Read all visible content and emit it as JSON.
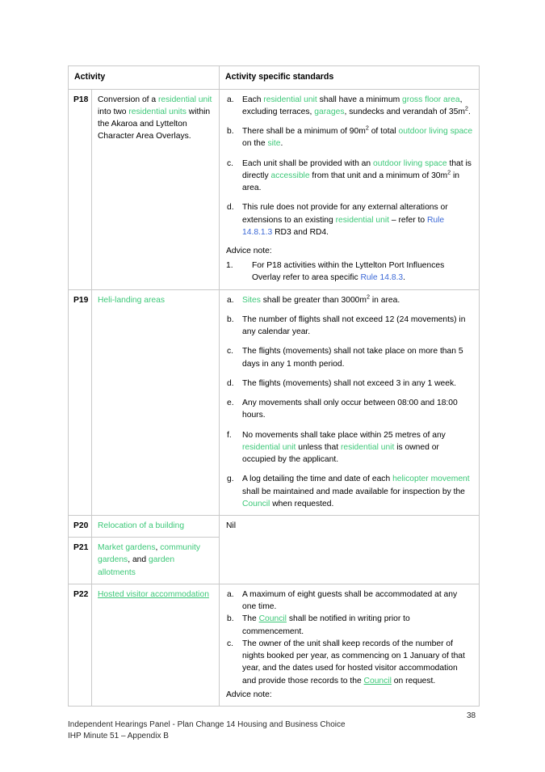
{
  "document": {
    "page_number": "38",
    "footer_line_1": "Independent Hearings Panel - Plan Change 14 Housing and Business Choice",
    "footer_line_2": "IHP Minute 51 – Appendix B"
  },
  "colors": {
    "link_green": "#3cc878",
    "link_blue": "#3b68d6",
    "border": "#c9c9c9",
    "text": "#000000"
  },
  "table": {
    "headers": {
      "activity": "Activity",
      "activity_specific_standards": "Activity specific standards"
    },
    "rows": [
      {
        "id": "P18",
        "description_html": "Conversion of a <span class=\"g\">residential unit</span> into two <span class=\"g\">residential units</span> within the Akaroa and Lyttelton Character Area Overlays.",
        "description_text": "Conversion of a residential unit into two residential units within the Akaroa and Lyttelton Character Area Overlays.",
        "standards": [
          {
            "marker": "a.",
            "html": "Each <span class=\"g\">residential unit</span> shall have a minimum <span class=\"g\">gross floor area</span>, excluding terraces, <span class=\"g\">garages</span>, sundecks and verandah of 35m<sup class=\"m\">2</sup>.",
            "text": "Each residential unit shall have a minimum gross floor area, excluding terraces, garages, sundecks and verandah of 35m2."
          },
          {
            "marker": "b.",
            "html": "There shall be a minimum of 90m<sup class=\"m\">2</sup> of total <span class=\"g\">outdoor living space</span> on the <span class=\"g\">site</span>.",
            "text": "There shall be a minimum of 90m2 of total outdoor living space on the site."
          },
          {
            "marker": "c.",
            "html": "Each unit shall be provided with an <span class=\"g\">outdoor living space</span> that is directly <span class=\"g\">accessible</span> from that unit and a minimum of 30m<sup class=\"m\">2</sup> in area.",
            "text": "Each unit shall be provided with an outdoor living space that is directly accessible from that unit and a minimum of 30m2 in area."
          },
          {
            "marker": "d.",
            "html": "This rule does not provide for any external alterations or extensions to an existing <span class=\"g\">residential unit</span> – refer to <span class=\"b\">Rule 14.8.1.3</span> RD3 and RD4.",
            "text": "This rule does not provide for any external alterations or extensions to an existing residential unit – refer to Rule 14.8.1.3 RD3 and RD4."
          }
        ],
        "advice_note_label": "Advice note:",
        "advice_notes": [
          {
            "marker": "1.",
            "html": "For P18 activities within the Lyttelton Port Influences Overlay refer to area specific <span class=\"b\">Rule 14.8.3</span>.",
            "text": "For P18 activities within the Lyttelton Port Influences Overlay refer to area specific Rule 14.8.3."
          }
        ]
      },
      {
        "id": "P19",
        "description_html": "<span class=\"g\">Heli-landing areas</span>",
        "description_text": "Heli-landing areas",
        "standards": [
          {
            "marker": "a.",
            "html": "<span class=\"g\">Sites</span> shall be greater than 3000m<sup class=\"m\">2</sup> in area.",
            "text": "Sites shall be greater than 3000m2 in area."
          },
          {
            "marker": "b.",
            "html": "The number of flights shall not exceed 12 (24 movements) in any calendar year.",
            "text": "The number of flights shall not exceed 12 (24 movements) in any calendar year."
          },
          {
            "marker": "c.",
            "html": "The flights (movements) shall not take place on more than 5 days in any 1 month period.",
            "text": "The flights (movements) shall not take place on more than 5 days in any 1 month period."
          },
          {
            "marker": "d.",
            "html": "The flights (movements) shall not exceed 3 in any 1 week.",
            "text": "The flights (movements) shall not exceed 3 in any 1 week."
          },
          {
            "marker": "e.",
            "html": "Any movements shall only occur between 08:00 and 18:00 hours.",
            "text": "Any movements shall only occur between 08:00 and 18:00 hours."
          },
          {
            "marker": "f.",
            "html": "No movements shall take place within 25 metres of any <span class=\"g\">residential unit</span> unless that <span class=\"g\">residential unit</span> is owned or occupied by the applicant.",
            "text": "No movements shall take place within 25 metres of any residential unit unless that residential unit is owned or occupied by the applicant."
          },
          {
            "marker": "g.",
            "html": "A log detailing the time and date of each <span class=\"g\">helicopter movement</span> shall be maintained and made available for inspection by the <span class=\"g\">Council</span> when requested.",
            "text": "A log detailing the time and date of each helicopter movement shall be maintained and made available for inspection by the Council when requested."
          }
        ]
      },
      {
        "id": "P20",
        "description_html": "<span class=\"g\">Relocation of a building</span>",
        "description_text": "Relocation of a building",
        "standards_text": "Nil"
      },
      {
        "id": "P21",
        "description_html": "<span class=\"g\">Market gardens</span>, <span class=\"g\">community gardens</span>, and <span class=\"g\">garden allotments</span>",
        "description_text": "Market gardens, community gardens, and garden allotments"
      },
      {
        "id": "P22",
        "description_html": "<span class=\"gu\">Hosted visitor accommodation</span>",
        "description_text": "Hosted visitor accommodation",
        "standards": [
          {
            "marker": "a.",
            "html": "A maximum of eight guests shall be accommodated at any one time.",
            "text": "A maximum of eight guests shall be accommodated at any one time."
          },
          {
            "marker": "b.",
            "html": "The <span class=\"gu\">Council</span> shall be notified in writing prior to commencement.",
            "text": "The Council shall be notified in writing prior to commencement."
          },
          {
            "marker": "c.",
            "html": "The owner of the unit shall keep records of the number of nights booked per year, as commencing on 1 January of that year, and the dates used for hosted visitor accommodation and provide those records to the <span class=\"gu\">Council</span> on request.",
            "text": "The owner of the unit shall keep records of the number of nights booked per year, as commencing on 1 January of that year, and the dates used for hosted visitor accommodation and provide those records to the Council on request."
          }
        ],
        "advice_note_label": "Advice note:"
      }
    ]
  }
}
